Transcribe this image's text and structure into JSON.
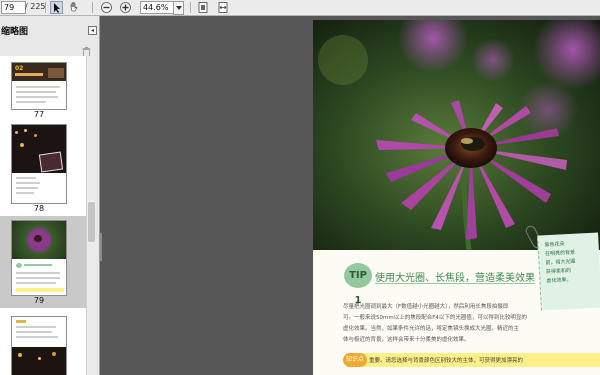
{
  "toolbar": {
    "page_current": "79",
    "page_total": "/ 225",
    "zoom": "44.6%",
    "icons": [
      "select-arrow-icon",
      "hand-tool-icon",
      "zoom-out-icon",
      "zoom-in-icon",
      "fit-page-icon",
      "fit-width-icon"
    ]
  },
  "thumbnails": {
    "title": "缩略图",
    "items": [
      {
        "label": "77",
        "selected": false
      },
      {
        "label": "78",
        "selected": false
      },
      {
        "label": "79",
        "selected": true
      },
      {
        "label": "",
        "selected": false
      }
    ]
  },
  "page": {
    "tip_number": "TIP 1",
    "tip_title": "使用大光圈、长焦段，营造柔美效果",
    "note": [
      "紫色花朵",
      "在明亮的背景",
      "前，用大光圈",
      "获得柔和的",
      "虚化效果。"
    ],
    "body": [
      "尽量把光圈调到最大（F数值越小光圈越大），然后利用长焦段拍摄即",
      "可。一般来说50mm以上的焦段配合F4以下的光圈值，可以得到比较明显的",
      "虚化效果。当然，如果条件允许的话，将定焦镜头换成大光圈、精近的主",
      "体与极近的背景，这样会带来十分柔美的虚化效果。"
    ],
    "know_label": "知识点",
    "know_text": "重要。请您选择与背景颜色区别较大的主体，可获得更加漂亮的"
  }
}
